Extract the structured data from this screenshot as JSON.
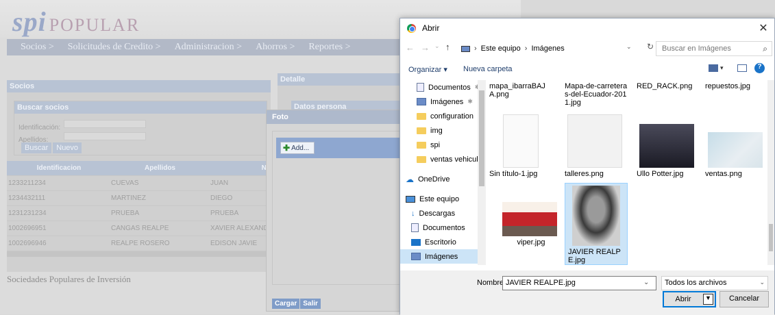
{
  "webapp": {
    "logo_main": "spi",
    "logo_sub": "POPULAR",
    "nav": [
      "Socios >",
      "Solicitudes de Credito >",
      "Administracion >",
      "Ahorros >",
      "Reportes >"
    ],
    "socios_title": "Socios",
    "buscar_title": "Buscar socios",
    "id_label": "Identificación:",
    "apellidos_label": "Apellidos:",
    "buscar_btn": "Buscar",
    "nuevo_btn": "Nuevo",
    "grid_headers": [
      "Identificacion",
      "Apellidos",
      "No"
    ],
    "grid_rows": [
      [
        "1233211234",
        "CUEVAS",
        "JUAN"
      ],
      [
        "1234432111",
        "MARTINEZ",
        "DIEGO"
      ],
      [
        "1231231234",
        "PRUEBA",
        "PRUEBA"
      ],
      [
        "1002696951",
        "CANGAS REALPE",
        "XAVIER ALEXANDI"
      ],
      [
        "1002696946",
        "REALPE ROSERO",
        "EDISON JAVIE"
      ]
    ],
    "footer": "Sociedades Populares de Inversión",
    "detalle_title": "Detalle",
    "datos_title": "Datos persona"
  },
  "foto": {
    "title": "Foto",
    "add_btn": "Add...",
    "cargar_btn": "Cargar",
    "salir_btn": "Salir"
  },
  "dialog": {
    "title": "Abrir",
    "path": [
      "Este equipo",
      "Imágenes"
    ],
    "search_placeholder": "Buscar en Imágenes",
    "organize": "Organizar ▾",
    "new_folder": "Nueva carpeta",
    "sidebar": [
      {
        "label": "Documentos",
        "icon": "doc-icon",
        "pin": "✱"
      },
      {
        "label": "Imágenes",
        "icon": "pictures-icon",
        "pin": "✱"
      },
      {
        "label": "configuration",
        "icon": "folder-icon"
      },
      {
        "label": "img",
        "icon": "folder-icon"
      },
      {
        "label": "spi",
        "icon": "folder-icon"
      },
      {
        "label": "ventas vehiculo",
        "icon": "folder-icon"
      },
      {
        "label": "OneDrive",
        "icon": "cloud-icon"
      },
      {
        "label": "Este equipo",
        "icon": "computer-icon"
      },
      {
        "label": "Descargas",
        "icon": "download-icon"
      },
      {
        "label": "Documentos",
        "icon": "doc-icon"
      },
      {
        "label": "Escritorio",
        "icon": "desktop-icon"
      },
      {
        "label": "Imágenes",
        "icon": "pictures-icon"
      }
    ],
    "files": [
      {
        "name": "mapa_ibarraBAJA.png"
      },
      {
        "name": "Mapa-de-carreteras-del-Ecuador-2011.jpg"
      },
      {
        "name": "RED_RACK.png"
      },
      {
        "name": "repuestos.jpg"
      },
      {
        "name": "Sin título-1.jpg"
      },
      {
        "name": "talleres.png"
      },
      {
        "name": "Ullo Potter.jpg"
      },
      {
        "name": "ventas.png"
      },
      {
        "name": "viper.jpg"
      },
      {
        "name": "JAVIER REALPE.jpg"
      }
    ],
    "name_label": "Nombre:",
    "name_value": "JAVIER REALPE.jpg",
    "filter": "Todos los archivos",
    "open_btn": "Abrir",
    "cancel_btn": "Cancelar"
  }
}
